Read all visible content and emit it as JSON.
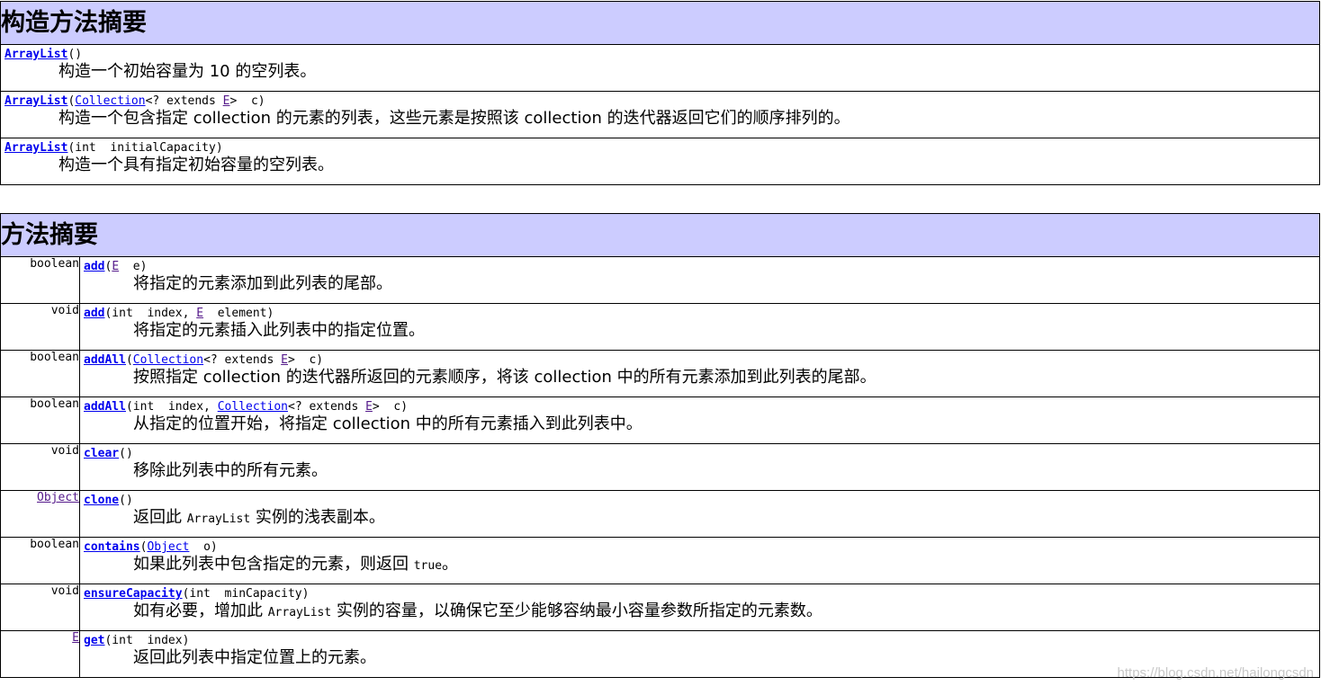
{
  "constructor_summary": {
    "title": "构造方法摘要",
    "rows": [
      {
        "name": "ArrayList",
        "sig": "()",
        "desc": "构造一个初始容量为 10 的空列表。"
      },
      {
        "name": "ArrayList",
        "sig_parts": [
          "(",
          "Collection",
          "<? extends ",
          "E",
          ">  c)"
        ],
        "desc": "构造一个包含指定 collection 的元素的列表，这些元素是按照该 collection 的迭代器返回它们的顺序排列的。"
      },
      {
        "name": "ArrayList",
        "sig": "(int  initialCapacity)",
        "desc": "构造一个具有指定初始容量的空列表。"
      }
    ]
  },
  "method_summary": {
    "title": "方法摘要",
    "rows": [
      {
        "ret": "boolean",
        "name": "add",
        "sig_parts": [
          "(",
          "E",
          "  e)"
        ],
        "desc": "将指定的元素添加到此列表的尾部。"
      },
      {
        "ret": "void",
        "name": "add",
        "sig_parts": [
          "(int  index, ",
          "E",
          "  element)"
        ],
        "desc": "将指定的元素插入此列表中的指定位置。"
      },
      {
        "ret": "boolean",
        "name": "addAll",
        "sig_parts": [
          "(",
          "Collection",
          "<? extends ",
          "E",
          ">  c)"
        ],
        "desc": "按照指定 collection 的迭代器所返回的元素顺序，将该 collection 中的所有元素添加到此列表的尾部。"
      },
      {
        "ret": "boolean",
        "name": "addAll",
        "sig_parts": [
          "(int  index, ",
          "Collection",
          "<? extends ",
          "E",
          ">  c)"
        ],
        "desc": "从指定的位置开始，将指定 collection 中的所有元素插入到此列表中。"
      },
      {
        "ret": "void",
        "name": "clear",
        "sig": "()",
        "desc": "移除此列表中的所有元素。"
      },
      {
        "ret": "Object",
        "name": "clone",
        "sig": "()",
        "desc_parts": [
          "返回此 ",
          "ArrayList",
          " 实例的浅表副本。"
        ]
      },
      {
        "ret": "boolean",
        "name": "contains",
        "sig_parts": [
          "(",
          "Object",
          "  o)"
        ],
        "desc_parts": [
          "如果此列表中包含指定的元素，则返回 ",
          "true",
          "。"
        ]
      },
      {
        "ret": "void",
        "name": "ensureCapacity",
        "sig": "(int  minCapacity)",
        "desc_parts": [
          "如有必要，增加此 ",
          "ArrayList",
          " 实例的容量，以确保它至少能够容纳最小容量参数所指定的元素数。"
        ]
      },
      {
        "ret": "E",
        "name": "get",
        "sig": "(int  index)",
        "desc": "返回此列表中指定位置上的元素。"
      }
    ]
  },
  "watermark": "https://blog.csdn.net/hailongcsdn"
}
